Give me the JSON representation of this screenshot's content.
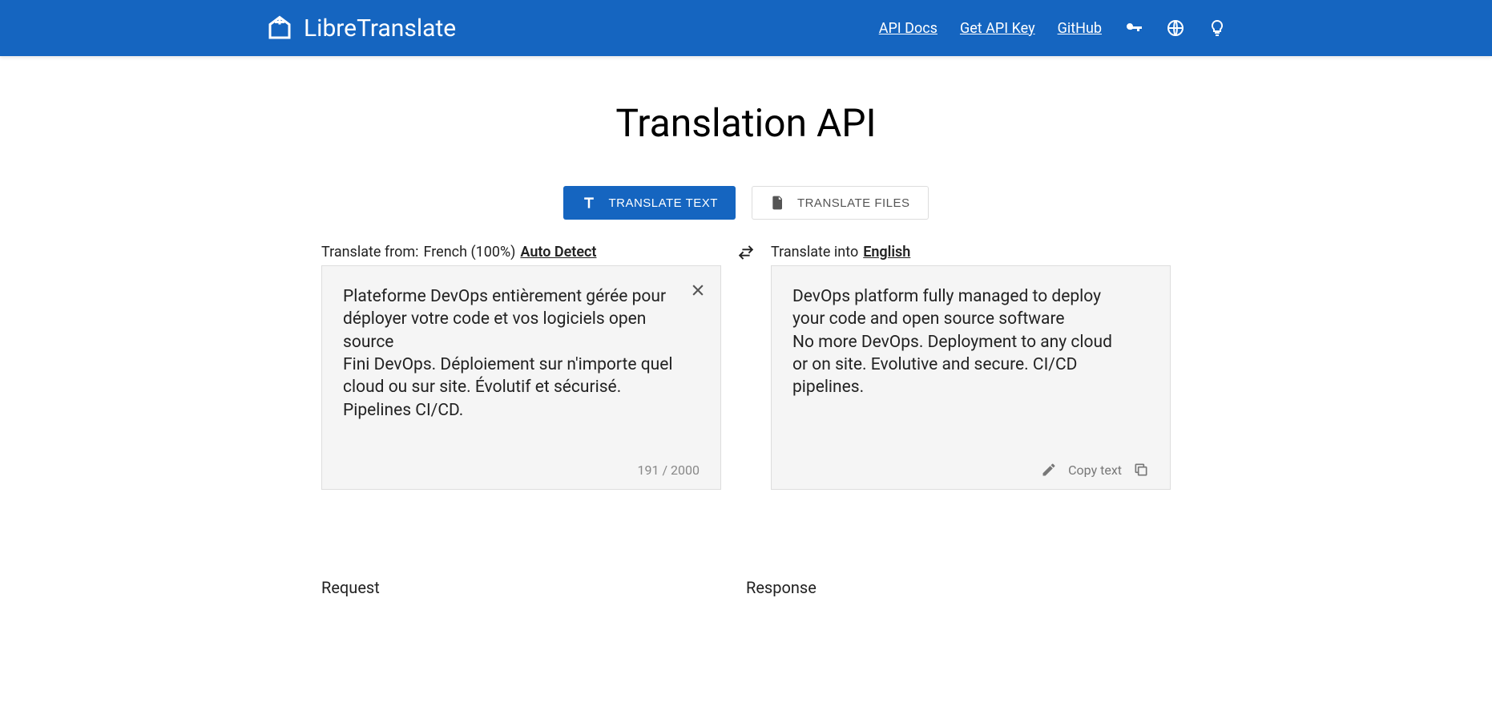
{
  "nav": {
    "brand": "LibreTranslate",
    "links": {
      "api_docs": "API Docs",
      "get_api_key": "Get API Key",
      "github": "GitHub"
    }
  },
  "page": {
    "title": "Translation API"
  },
  "tabs": {
    "text": "TRANSLATE TEXT",
    "files": "TRANSLATE FILES"
  },
  "source": {
    "label_prefix": "Translate from: ",
    "detected": "French (100%)",
    "auto_detect": "Auto Detect",
    "text": "Plateforme DevOps entièrement gérée pour déployer votre code et vos logiciels open source\nFini DevOps. Déploiement sur n'importe quel cloud ou sur site. Évolutif et sécurisé. Pipelines CI/CD.",
    "count": "191 / 2000"
  },
  "target": {
    "label_prefix": "Translate into",
    "language": "English",
    "text": "DevOps platform fully managed to deploy your code and open source software\nNo more DevOps. Deployment to any cloud or on site. Evolutive and secure. CI/CD pipelines.",
    "copy_label": "Copy text"
  },
  "sections": {
    "request": "Request",
    "response": "Response"
  }
}
